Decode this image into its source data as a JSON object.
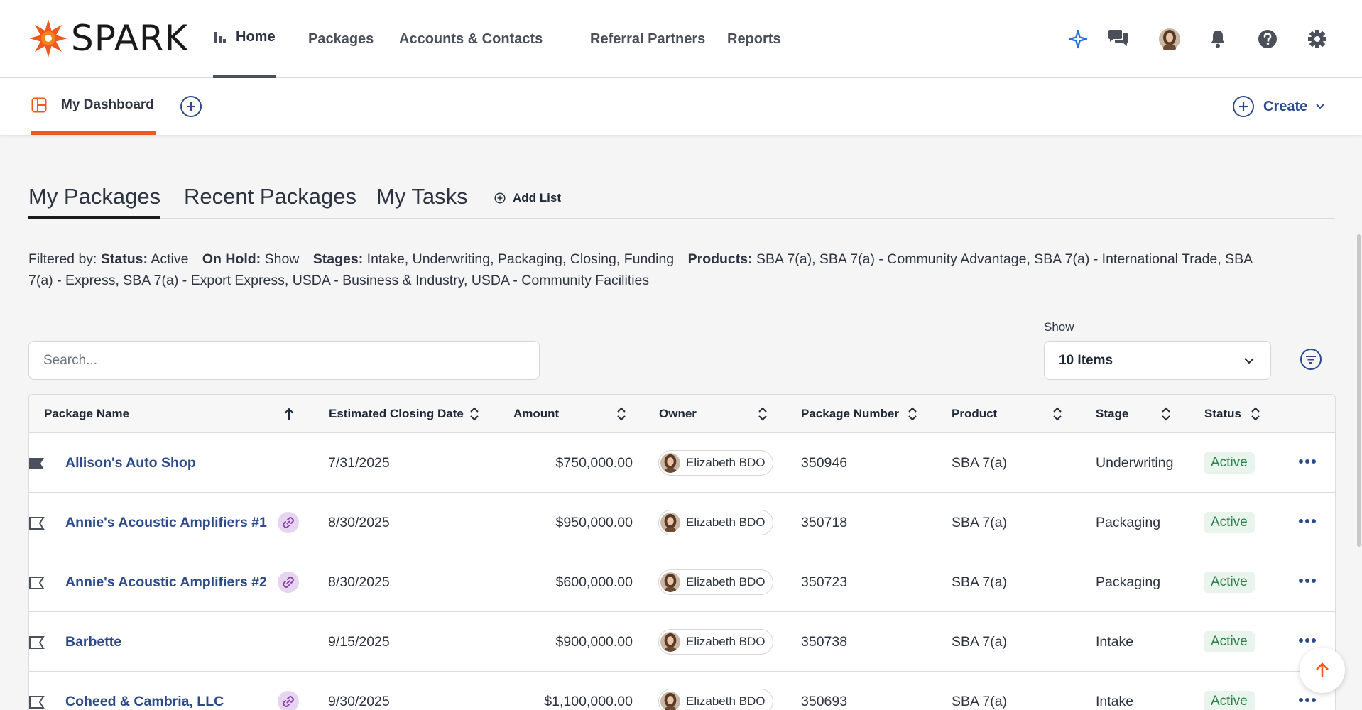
{
  "app": {
    "logo_text": "SPARK"
  },
  "topnav": {
    "items": [
      {
        "label": "Home",
        "icon": "bar-chart-icon",
        "active": true
      },
      {
        "label": "Packages"
      },
      {
        "label": "Accounts & Contacts",
        "has_dropdown": true
      },
      {
        "label": "Referral Partners"
      },
      {
        "label": "Reports"
      }
    ],
    "icons": [
      "sparkle-icon",
      "chat-icon",
      "user-avatar",
      "bell-icon",
      "help-icon",
      "gear-icon"
    ]
  },
  "subnav": {
    "dashboard_tab": "My Dashboard",
    "create_label": "Create"
  },
  "list_tabs": {
    "tabs": [
      "My Packages",
      "Recent Packages",
      "My Tasks"
    ],
    "active": "My Packages",
    "add_list_label": "Add List"
  },
  "filters": {
    "prefix": "Filtered by:",
    "status_label": "Status:",
    "status_value": "Active",
    "onhold_label": "On Hold:",
    "onhold_value": "Show",
    "stages_label": "Stages:",
    "stages_value": "Intake, Underwriting, Packaging, Closing, Funding",
    "products_label": "Products:",
    "products_value": "SBA 7(a), SBA 7(a) - Community Advantage, SBA 7(a) - International Trade, SBA 7(a) - Express, SBA 7(a) - Export Express, USDA - Business & Industry, USDA - Community Facilities"
  },
  "search": {
    "placeholder": "Search..."
  },
  "show": {
    "label": "Show",
    "selected": "10 Items"
  },
  "table": {
    "columns": [
      "Package Name",
      "Estimated Closing Date",
      "Amount",
      "Owner",
      "Package Number",
      "Product",
      "Stage",
      "Status"
    ],
    "rows": [
      {
        "name": "Allison's Auto Shop",
        "flagged": true,
        "linked": false,
        "date": "7/31/2025",
        "amount": "$750,000.00",
        "owner": "Elizabeth BDO",
        "number": "350946",
        "product": "SBA 7(a)",
        "stage": "Underwriting",
        "status": "Active"
      },
      {
        "name": "Annie's Acoustic Amplifiers #1",
        "flagged": false,
        "linked": true,
        "date": "8/30/2025",
        "amount": "$950,000.00",
        "owner": "Elizabeth BDO",
        "number": "350718",
        "product": "SBA 7(a)",
        "stage": "Packaging",
        "status": "Active"
      },
      {
        "name": "Annie's Acoustic Amplifiers #2",
        "flagged": false,
        "linked": true,
        "date": "8/30/2025",
        "amount": "$600,000.00",
        "owner": "Elizabeth BDO",
        "number": "350723",
        "product": "SBA 7(a)",
        "stage": "Packaging",
        "status": "Active"
      },
      {
        "name": "Barbette",
        "flagged": false,
        "linked": false,
        "date": "9/15/2025",
        "amount": "$900,000.00",
        "owner": "Elizabeth BDO",
        "number": "350738",
        "product": "SBA 7(a)",
        "stage": "Intake",
        "status": "Active"
      },
      {
        "name": "Coheed & Cambria, LLC",
        "flagged": false,
        "linked": true,
        "date": "9/30/2025",
        "amount": "$1,100,000.00",
        "owner": "Elizabeth BDO",
        "number": "350693",
        "product": "SBA 7(a)",
        "stage": "Intake",
        "status": "Active"
      }
    ]
  },
  "colors": {
    "brand_orange": "#f0581e",
    "link_blue": "#2d4a8a",
    "status_green": "#2e7d4a"
  }
}
